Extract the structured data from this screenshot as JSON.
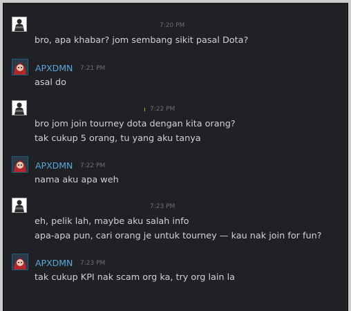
{
  "messages": [
    {
      "sender": "self",
      "time": "7:20 PM",
      "lines": [
        "bro, apa khabar? jom sembang sikit pasal Dota?"
      ]
    },
    {
      "sender": "APXDMN",
      "time": "7:21 PM",
      "lines": [
        "asal do"
      ]
    },
    {
      "sender": "self",
      "time": "7:22 PM",
      "lines": [
        "bro jom join tourney dota dengan kita orang?",
        "tak cukup 5 orang, tu yang aku tanya"
      ]
    },
    {
      "sender": "APXDMN",
      "time": "7:22 PM",
      "lines": [
        "nama aku apa weh"
      ]
    },
    {
      "sender": "self",
      "time": "7:23 PM",
      "lines": [
        "eh, pelik lah, maybe aku salah info",
        "apa-apa pun, cari orang je untuk tourney — kau nak join for fun?"
      ]
    },
    {
      "sender": "APXDMN",
      "time": "7:23 PM",
      "lines": [
        "tak cukup KPI nak scam org ka, try org lain la"
      ]
    }
  ],
  "colors": {
    "background": "#1f2125",
    "username": "#5aa8dc",
    "text": "#d0d2d5",
    "timestamp": "#6b6f76"
  }
}
